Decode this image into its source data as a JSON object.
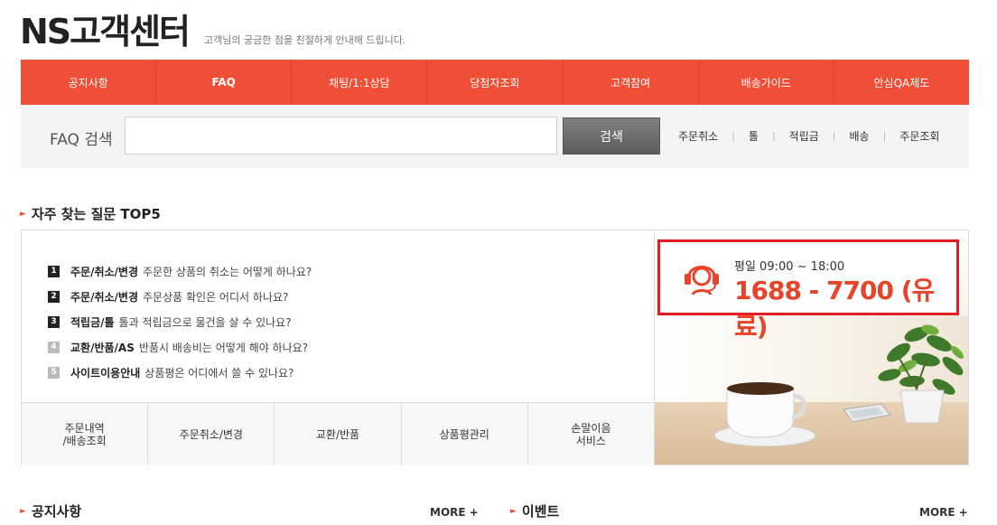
{
  "header": {
    "brand": "NS고객센터",
    "tagline": "고객님의 궁금한 점을 친절하게 안내해 드립니다."
  },
  "nav": {
    "items": [
      {
        "label": "공지사항"
      },
      {
        "label": "FAQ"
      },
      {
        "label": "채팅/1:1상담"
      },
      {
        "label": "당첨자조회"
      },
      {
        "label": "고객참여"
      },
      {
        "label": "배송가이드"
      },
      {
        "label": "안심QA제도"
      }
    ]
  },
  "search": {
    "label": "FAQ 검색",
    "value": "",
    "button_label": "검색",
    "quick_links": [
      "주문취소",
      "톨",
      "적립금",
      "배송",
      "주문조회"
    ]
  },
  "top5": {
    "title": "자주 찾는 질문 TOP5",
    "items": [
      {
        "num": "1",
        "category": "주문/취소/변경",
        "question": "주문한 상품의 취소는 어떻게 하나요?"
      },
      {
        "num": "2",
        "category": "주문/취소/변경",
        "question": "주문상품 확인은 어디서 하나요?"
      },
      {
        "num": "3",
        "category": "적립금/톨",
        "question": "톨과 적립금으로 물건을 살 수 있나요?"
      },
      {
        "num": "4",
        "category": "교환/반품/AS",
        "question": "반품시 배송비는 어떻게 해야 하나요?"
      },
      {
        "num": "5",
        "category": "사이트이용안내",
        "question": "상품평은 어디에서 쓸 수 있나요?"
      }
    ],
    "tabs": [
      {
        "line1": "주문내역",
        "line2": "/배송조회"
      },
      {
        "line1": "주문취소/변경",
        "line2": ""
      },
      {
        "line1": "교환/반품",
        "line2": ""
      },
      {
        "line1": "상품평관리",
        "line2": ""
      },
      {
        "line1": "손말이음",
        "line2": "서비스"
      }
    ]
  },
  "promo": {
    "hours": "평일 09:00 ~ 18:00",
    "phone": "1688 - 7700 (유료)"
  },
  "bottom": {
    "notice_title": "공지사항",
    "event_title": "이벤트",
    "more_label": "MORE",
    "plus": "+"
  },
  "colors": {
    "accent": "#ee4f36",
    "phone_border": "#e11e26"
  }
}
